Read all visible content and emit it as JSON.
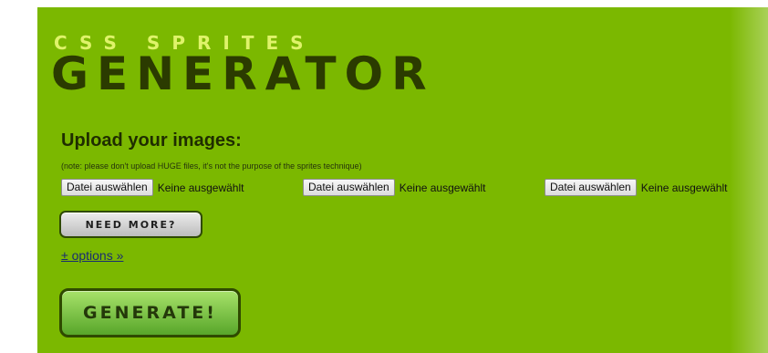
{
  "header": {
    "subtitle": "CSS SPRITES",
    "title": "GENERATOR"
  },
  "upload": {
    "title": "Upload your images:",
    "note": "(note: please don't upload HUGE files, it's not the purpose of the sprites technique)"
  },
  "file_inputs": [
    {
      "button_label": "Datei auswählen",
      "status": "Keine ausgewählt"
    },
    {
      "button_label": "Datei auswählen",
      "status": "Keine ausgewählt"
    },
    {
      "button_label": "Datei auswählen",
      "status": "Keine ausgewählt"
    }
  ],
  "actions": {
    "need_more_label": "NEED MORE?",
    "options_label": "± options »",
    "generate_label": "GENERATE!"
  },
  "colors": {
    "background": "#7bb800",
    "logo_small": "#dff36a",
    "logo_big": "#2b3b00",
    "link": "#1a2d70"
  }
}
